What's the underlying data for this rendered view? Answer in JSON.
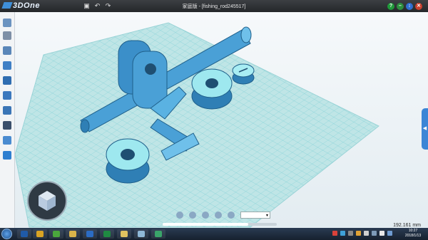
{
  "app": {
    "logo_text": "3DOne",
    "document_title": "家庭版 - [fishing_rod245517]"
  },
  "titlebar": {
    "quick_actions": [
      "save-icon",
      "undo-icon",
      "redo-icon"
    ],
    "window_buttons": [
      {
        "name": "help-button",
        "glyph": "?",
        "color": "#1f9a3a"
      },
      {
        "name": "minimize-button",
        "glyph": "–",
        "color": "#2d8f3e"
      },
      {
        "name": "restore-button",
        "glyph": "↕",
        "color": "#2e6ed1"
      },
      {
        "name": "close-button",
        "glyph": "✕",
        "color": "#c8402f"
      }
    ]
  },
  "sidebar": {
    "tools": [
      {
        "name": "basic-shapes-tool-icon",
        "color": "#6b93c0"
      },
      {
        "name": "sketch-tool-icon",
        "color": "#7d8fa6"
      },
      {
        "name": "sketch-edit-tool-icon",
        "color": "#5a86b8"
      },
      {
        "name": "feature-tool-icon",
        "color": "#3f7fc5"
      },
      {
        "name": "special-feature-tool-icon",
        "color": "#2f6db1"
      },
      {
        "name": "move-tool-icon",
        "color": "#3b78bd"
      },
      {
        "name": "combine-tool-icon",
        "color": "#3a75b6"
      },
      {
        "name": "array-tool-icon",
        "color": "#3a4f6b"
      },
      {
        "name": "measure-tool-icon",
        "color": "#4a8bd0"
      },
      {
        "name": "material-tool-icon",
        "color": "#2e7fd0"
      }
    ]
  },
  "viewport": {
    "right_tab_glyph": "◀"
  },
  "bottom_toolbar": {
    "icons": [
      "view-orientation-icon",
      "render-mode-icon",
      "display-icon",
      "zoom-fit-icon",
      "zoom-icon"
    ],
    "zoom_select_value": "▾"
  },
  "status": {
    "measurement": "192.161 mm"
  },
  "taskbar": {
    "apps": [
      {
        "name": "photoshop-task-icon",
        "color": "#1f5aa8"
      },
      {
        "name": "chrome-task-icon",
        "color": "#d8a324"
      },
      {
        "name": "360-browser-task-icon",
        "color": "#4aa63c"
      },
      {
        "name": "folder-task-icon",
        "color": "#d9b44a"
      },
      {
        "name": "word-task-icon",
        "color": "#2b6cc4"
      },
      {
        "name": "excel-task-icon",
        "color": "#1f8a42"
      },
      {
        "name": "files-task-icon",
        "color": "#e0c360"
      },
      {
        "name": "3done-task-icon",
        "color": "#8fb9d8"
      },
      {
        "name": "mail-task-icon",
        "color": "#3aa56a"
      }
    ],
    "tray_colors": [
      "#d9423a",
      "#3fa1d8",
      "#888888",
      "#e0a235",
      "#cfcfcf",
      "#7d9ab8",
      "#e8e8e8",
      "#6f9cd2"
    ],
    "time": "10:27",
    "date": "2018/1/13"
  }
}
